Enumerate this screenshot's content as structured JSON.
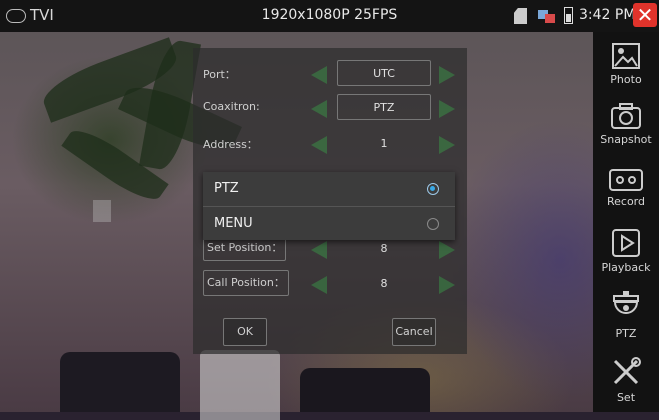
{
  "statusbar": {
    "mode": "TVI",
    "resolution": "1920x1080P 25FPS",
    "time": "3:42 PM",
    "close_symbol": "✕"
  },
  "sidebar": {
    "items": [
      {
        "label": "Photo",
        "icon": "photo-icon"
      },
      {
        "label": "Snapshot",
        "icon": "camera-icon"
      },
      {
        "label": "Record",
        "icon": "video-camera-icon"
      },
      {
        "label": "Playback",
        "icon": "play-icon"
      },
      {
        "label": "PTZ",
        "icon": "dome-camera-icon"
      },
      {
        "label": "Set",
        "icon": "tools-icon"
      }
    ]
  },
  "dialog": {
    "rows": [
      {
        "label": "Port：",
        "value": "UTC"
      },
      {
        "label": "Coaxitron:",
        "value": "PTZ"
      },
      {
        "label": "Address：",
        "value": "1"
      },
      {
        "label": "Set Position：",
        "value": "8"
      },
      {
        "label": "Call Position：",
        "value": "8"
      }
    ],
    "ok_label": "OK",
    "cancel_label": "Cancel"
  },
  "popup": {
    "options": [
      {
        "label": "PTZ",
        "selected": true
      },
      {
        "label": "MENU",
        "selected": false
      }
    ]
  },
  "colors": {
    "accent": "#39a9e6",
    "arrow": "#3aa04a",
    "close": "#e0332b"
  }
}
